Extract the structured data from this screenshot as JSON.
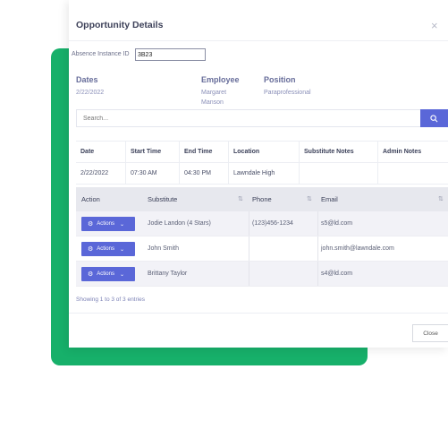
{
  "modal": {
    "title": "Opportunity Details",
    "close_glyph": "×"
  },
  "absence": {
    "label": "Absence Instance ID",
    "value": "3B23"
  },
  "info": {
    "dates": {
      "label": "Dates",
      "value": "2/22/2022"
    },
    "employee": {
      "label": "Employee",
      "value_line1": "Margaret",
      "value_line2": "Manson"
    },
    "position": {
      "label": "Position",
      "value": "Paraprofessional"
    }
  },
  "search": {
    "placeholder": "Search..."
  },
  "schedule_table": {
    "headers": [
      "Date",
      "Start Time",
      "End Time",
      "Location",
      "Substitute Notes",
      "Admin Notes"
    ],
    "row": [
      "2/22/2022",
      "07:30 AM",
      "04:30 PM",
      "Lawndale High",
      "",
      ""
    ]
  },
  "substitutes_table": {
    "headers": {
      "action": "Action",
      "substitute": "Substitute",
      "phone": "Phone",
      "email": "Email"
    },
    "action_label": "Actions",
    "rows": [
      {
        "substitute": "Jodie Landon (4 Stars)",
        "phone": "(123)456-1234",
        "email": "s5@ld.com"
      },
      {
        "substitute": "John Smith",
        "phone": "",
        "email": "john.smith@lawndale.com"
      },
      {
        "substitute": "Brittany Taylor",
        "phone": "",
        "email": "s4@ld.com"
      }
    ]
  },
  "pagination": {
    "entries_text": "Showing 1 to 3 of 3 entries"
  },
  "footer": {
    "close_label": "Close"
  },
  "colors": {
    "accent": "#5a67d8",
    "brand_green": "#17b06a"
  },
  "icons": [
    "close-icon",
    "search-icon",
    "sort-icon",
    "gear-icon",
    "chevron-down-icon"
  ]
}
